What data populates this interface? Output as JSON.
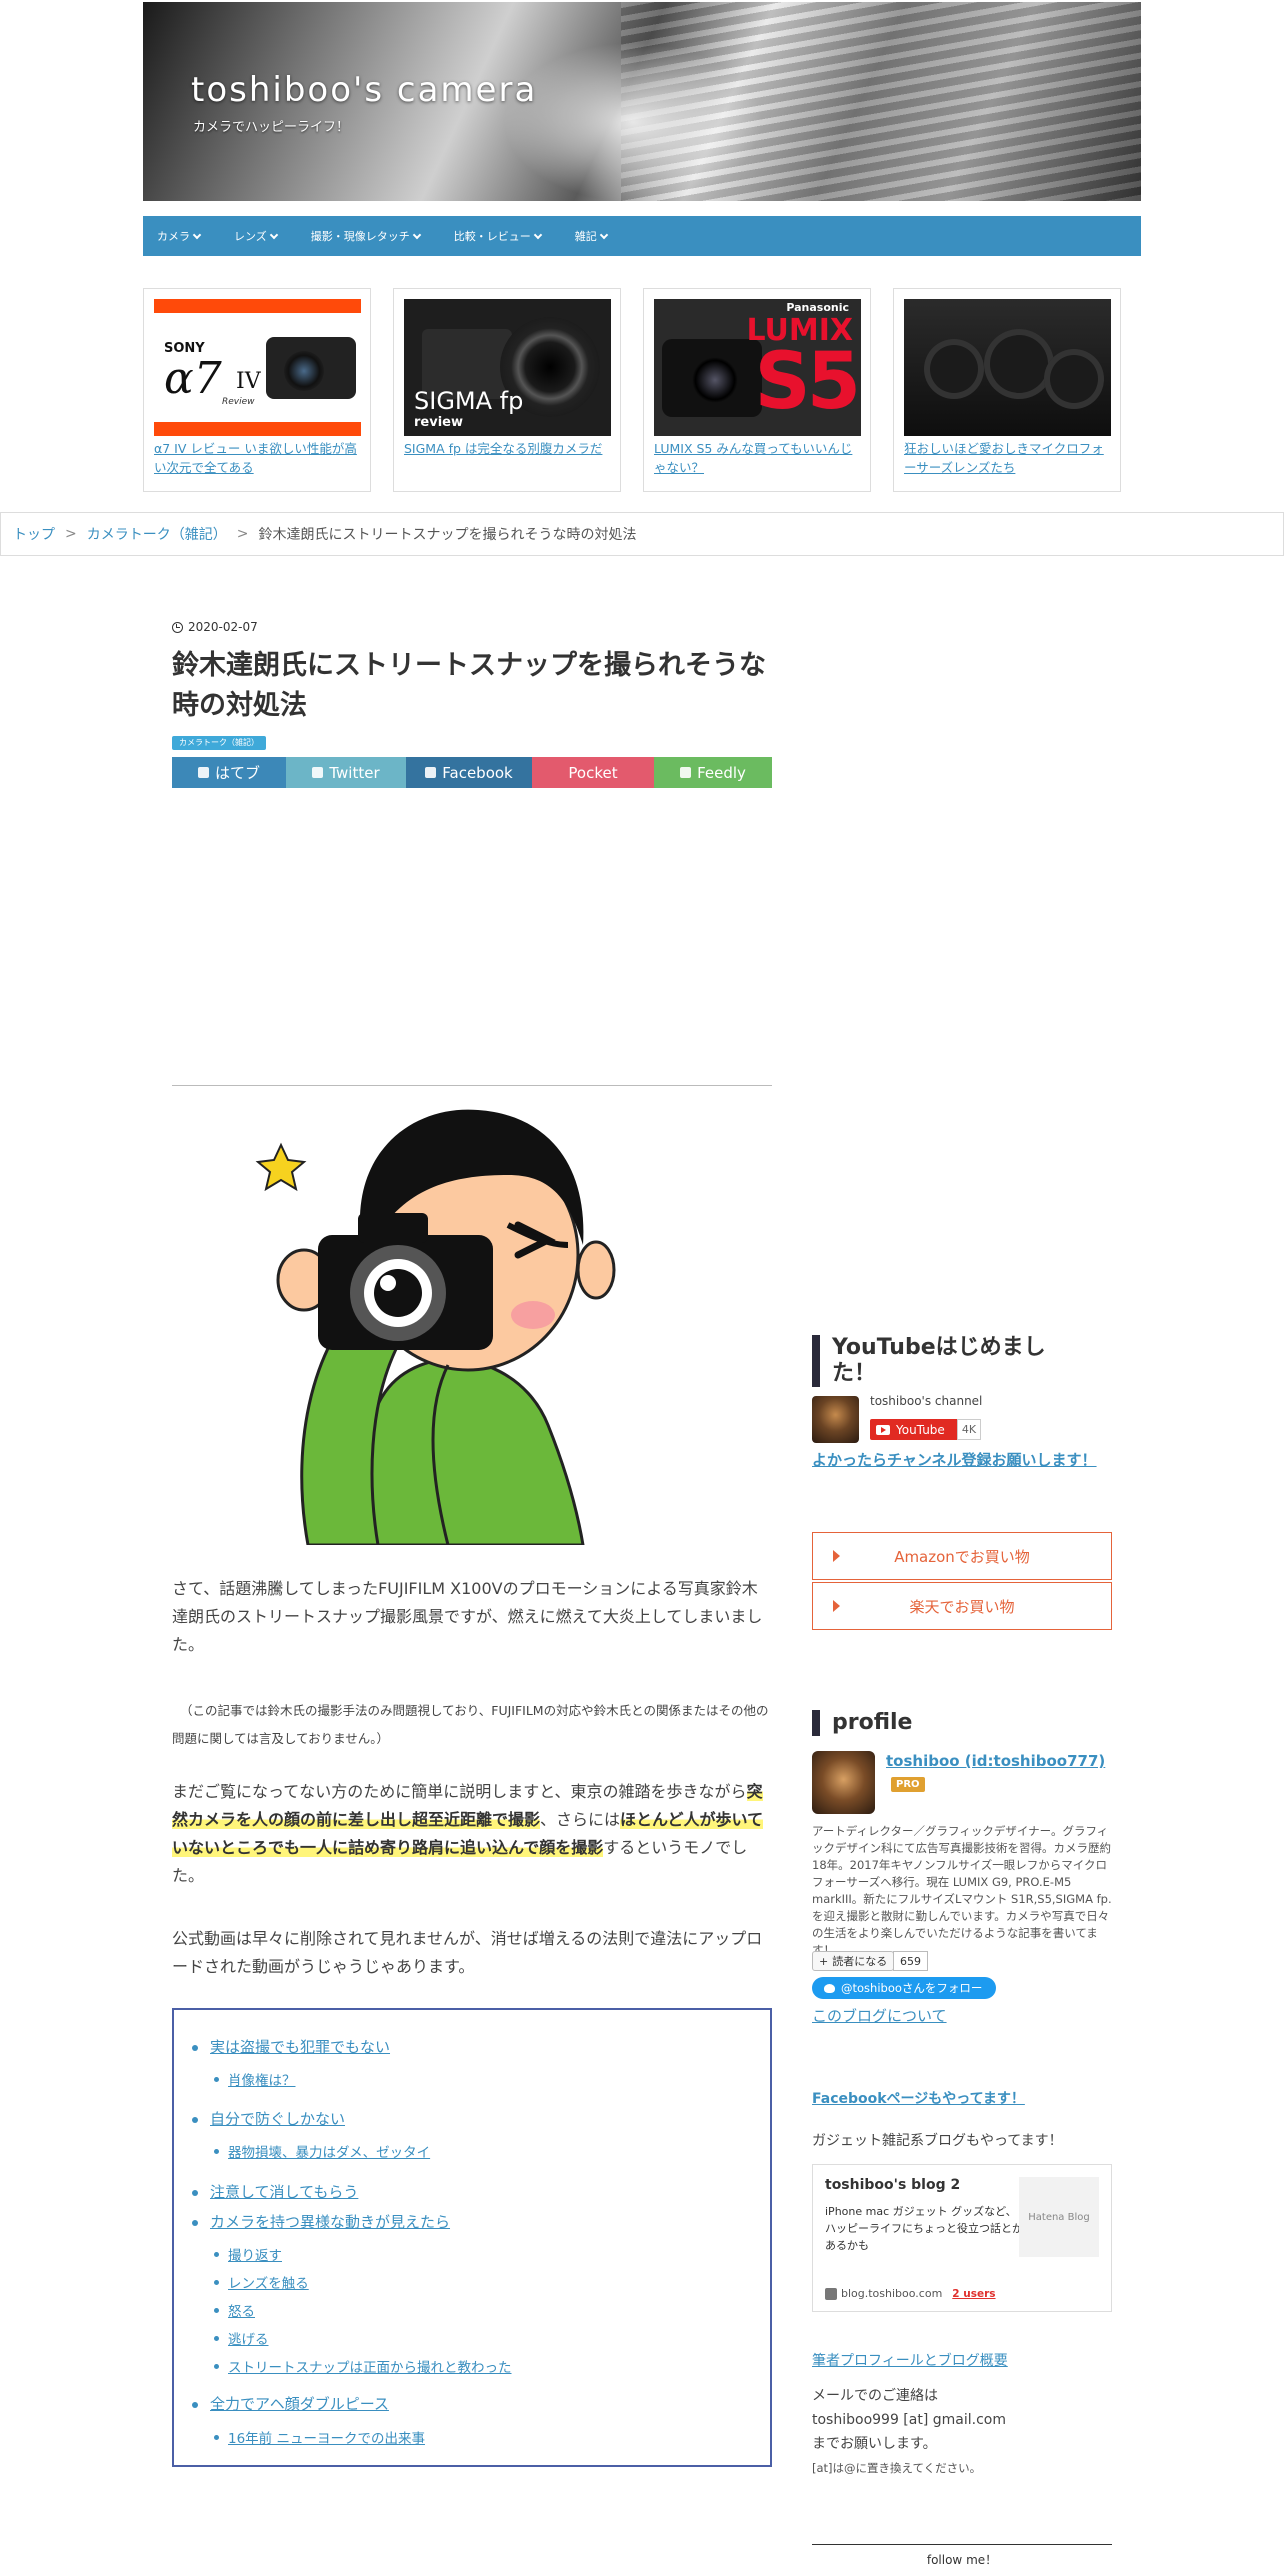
{
  "header": {
    "title": "toshiboo's camera",
    "subtitle": "カメラでハッピーライフ！"
  },
  "nav": {
    "items": [
      "カメラ",
      "レンズ",
      "撮影・現像レタッチ",
      "比較・レビュー",
      "雑記"
    ]
  },
  "featured": [
    {
      "caption": "α7 IV レビュー いま欲しい性能が高い次元で全てある",
      "thumb_text": [
        "SONY",
        "α7",
        "IV",
        "Review"
      ]
    },
    {
      "caption": "SIGMA fp は完全なる別腹カメラだ",
      "thumb_text": [
        "SIGMA fp",
        "review"
      ]
    },
    {
      "caption": "LUMIX S5 みんな買ってもいいんじゃない？",
      "thumb_text": [
        "Panasonic",
        "LUMIX",
        "S5"
      ]
    },
    {
      "caption": "狂おしいほど愛おしきマイクロフォーサーズレンズたち",
      "thumb_text": []
    }
  ],
  "breadcrumb": {
    "home": "トップ",
    "category": "カメラトーク（雑記）",
    "current": "鈴木達朗氏にストリートスナップを撮られそうな時の対処法",
    "separator": ">"
  },
  "article": {
    "date": "2020-02-07",
    "title": "鈴木達朗氏にストリートスナップを撮られそうな時の対処法",
    "tag": "カメラトーク（雑記）",
    "share": {
      "hatena": "はてブ",
      "twitter": "Twitter",
      "facebook": "Facebook",
      "pocket": "Pocket",
      "feedly": "Feedly"
    },
    "p1": "さて、話題沸騰してしまったFUJIFILM X100Vのプロモーションによる写真家鈴木達朗氏のストリートスナップ撮影風景ですが、燃えに燃えて大炎上してしまいました。",
    "note": "（この記事では鈴木氏の撮影手法のみ問題視しており、FUJIFILMの対応や鈴木氏との関係またはその他の問題に関しては言及しておりません。）",
    "p3_a": "まだご覧になってない方のために簡単に説明しますと、東京の雑踏を歩きながら",
    "p3_hl1": "突然カメラを人の顔の前に差し出し超至近距離で撮影",
    "p3_b": "、さらには",
    "p3_hl2": "ほとんど人が歩いていないところでも一人に詰め寄り路肩に追い込んで顔を撮影",
    "p3_c": "するというモノでした。",
    "p4": "公式動画は早々に削除されて見れませんが、消せば増えるの法則で違法にアップロードされた動画がうじゃうじゃあります。"
  },
  "toc": [
    {
      "label": "実は盗撮でも犯罪でもない",
      "level": 1
    },
    {
      "label": "肖像権は？",
      "level": 2
    },
    {
      "label": "自分で防ぐしかない",
      "level": 1
    },
    {
      "label": "器物損壊、暴力はダメ、ゼッタイ",
      "level": 2
    },
    {
      "label": "注意して消してもらう",
      "level": 1
    },
    {
      "label": "カメラを持つ異様な動きが見えたら",
      "level": 1
    },
    {
      "label": "撮り返す",
      "level": 2
    },
    {
      "label": "レンズを触る",
      "level": 2
    },
    {
      "label": "怒る",
      "level": 2
    },
    {
      "label": "逃げる",
      "level": 2
    },
    {
      "label": "ストリートスナップは正面から撮れと教わった",
      "level": 2
    },
    {
      "label": "全力でアヘ顔ダブルピース",
      "level": 1
    },
    {
      "label": "16年前 ニューヨークでの出来事",
      "level": 2
    }
  ],
  "sidebar": {
    "youtube": {
      "heading": "YouTubeはじめました！",
      "channel": "toshiboo's channel",
      "button": "YouTube",
      "count": "4K",
      "link": "よかったらチャンネル登録お願いします！"
    },
    "buy": {
      "amazon": "Amazonでお買い物",
      "rakuten": "楽天でお買い物"
    },
    "profile": {
      "heading": "profile",
      "name": "toshiboo (id:toshiboo777)",
      "badge": "PRO",
      "bio": "アートディレクター／グラフィックデザイナー。グラフィックデザイン科にて広告写真撮影技術を習得。カメラ歴約18年。2017年キヤノンフルサイズ一眼レフからマイクロフォーサーズへ移行。現在 LUMIX G9, PRO.E-M5 markIII。新たにフルサイズLマウント S1R,S5,SIGMA fp.を迎え撮影と散財に勤しんでいます。カメラや写真で日々の生活をより楽しんでいただけるような記事を書いてます！",
      "reader_label": "読者になる",
      "reader_count": "659",
      "twitter_follow": "@toshibooさんをフォロー",
      "about": "このブログについて"
    },
    "facebook_link": "Facebookページもやってます！",
    "gadget_text": "ガジェット雑記系ブログもやってます！",
    "blog_card": {
      "title": "toshiboo's blog 2",
      "desc": "iPhone mac ガジェット グッズなど、ハッピーライフにちょっと役立つ話とかあるかも",
      "image_label": "Hatena Blog",
      "url": "blog.toshiboo.com",
      "users": "2 users"
    },
    "profile_link": "筆者プロフィールとブログ概要",
    "contact": {
      "line1": "メールでのご連絡は",
      "line2": "toshiboo999 [at] gmail.com",
      "line3": "までお願いします。",
      "line4": "[at]は@に置き換えてください。"
    },
    "follow": "follow me！"
  },
  "colors": {
    "nav": "#3a8fc0",
    "link": "#3a8fc0",
    "highlight": "#fff57a",
    "toc_border": "#4b5fa6",
    "buy_accent": "#e5633a"
  }
}
